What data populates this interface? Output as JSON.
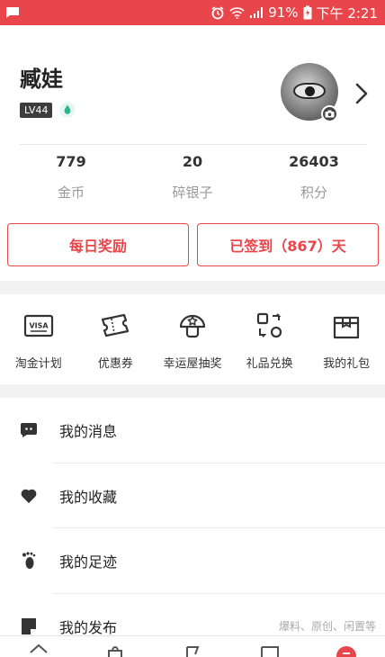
{
  "status_bar": {
    "battery": "91%",
    "time": "下午 2:21",
    "bg_color": "#e8464a",
    "icons": [
      "chat-notification-icon",
      "alarm-icon",
      "wifi-icon",
      "signal-icon",
      "battery-icon"
    ]
  },
  "profile": {
    "username": "臧娃",
    "level": "LV44",
    "stats": [
      {
        "value": "779",
        "label": "金币"
      },
      {
        "value": "20",
        "label": "碎银子"
      },
      {
        "value": "26403",
        "label": "积分"
      }
    ],
    "daily_reward_label": "每日奖励",
    "checkin_label": "已签到（867）天"
  },
  "features": [
    {
      "label": "淘金计划",
      "icon": "visa-card-icon"
    },
    {
      "label": "优惠券",
      "icon": "ticket-icon"
    },
    {
      "label": "幸运屋抽奖",
      "icon": "mushroom-icon"
    },
    {
      "label": "礼品兑换",
      "icon": "exchange-icon"
    },
    {
      "label": "我的礼包",
      "icon": "gift-box-icon"
    }
  ],
  "menu": [
    {
      "label": "我的消息",
      "icon": "message-icon"
    },
    {
      "label": "我的收藏",
      "icon": "heart-icon"
    },
    {
      "label": "我的足迹",
      "icon": "footprint-icon"
    },
    {
      "label": "我的发布",
      "icon": "publish-icon",
      "hint": "爆料、原创、闲置等"
    }
  ],
  "theme": {
    "accent": "#e8464a"
  }
}
